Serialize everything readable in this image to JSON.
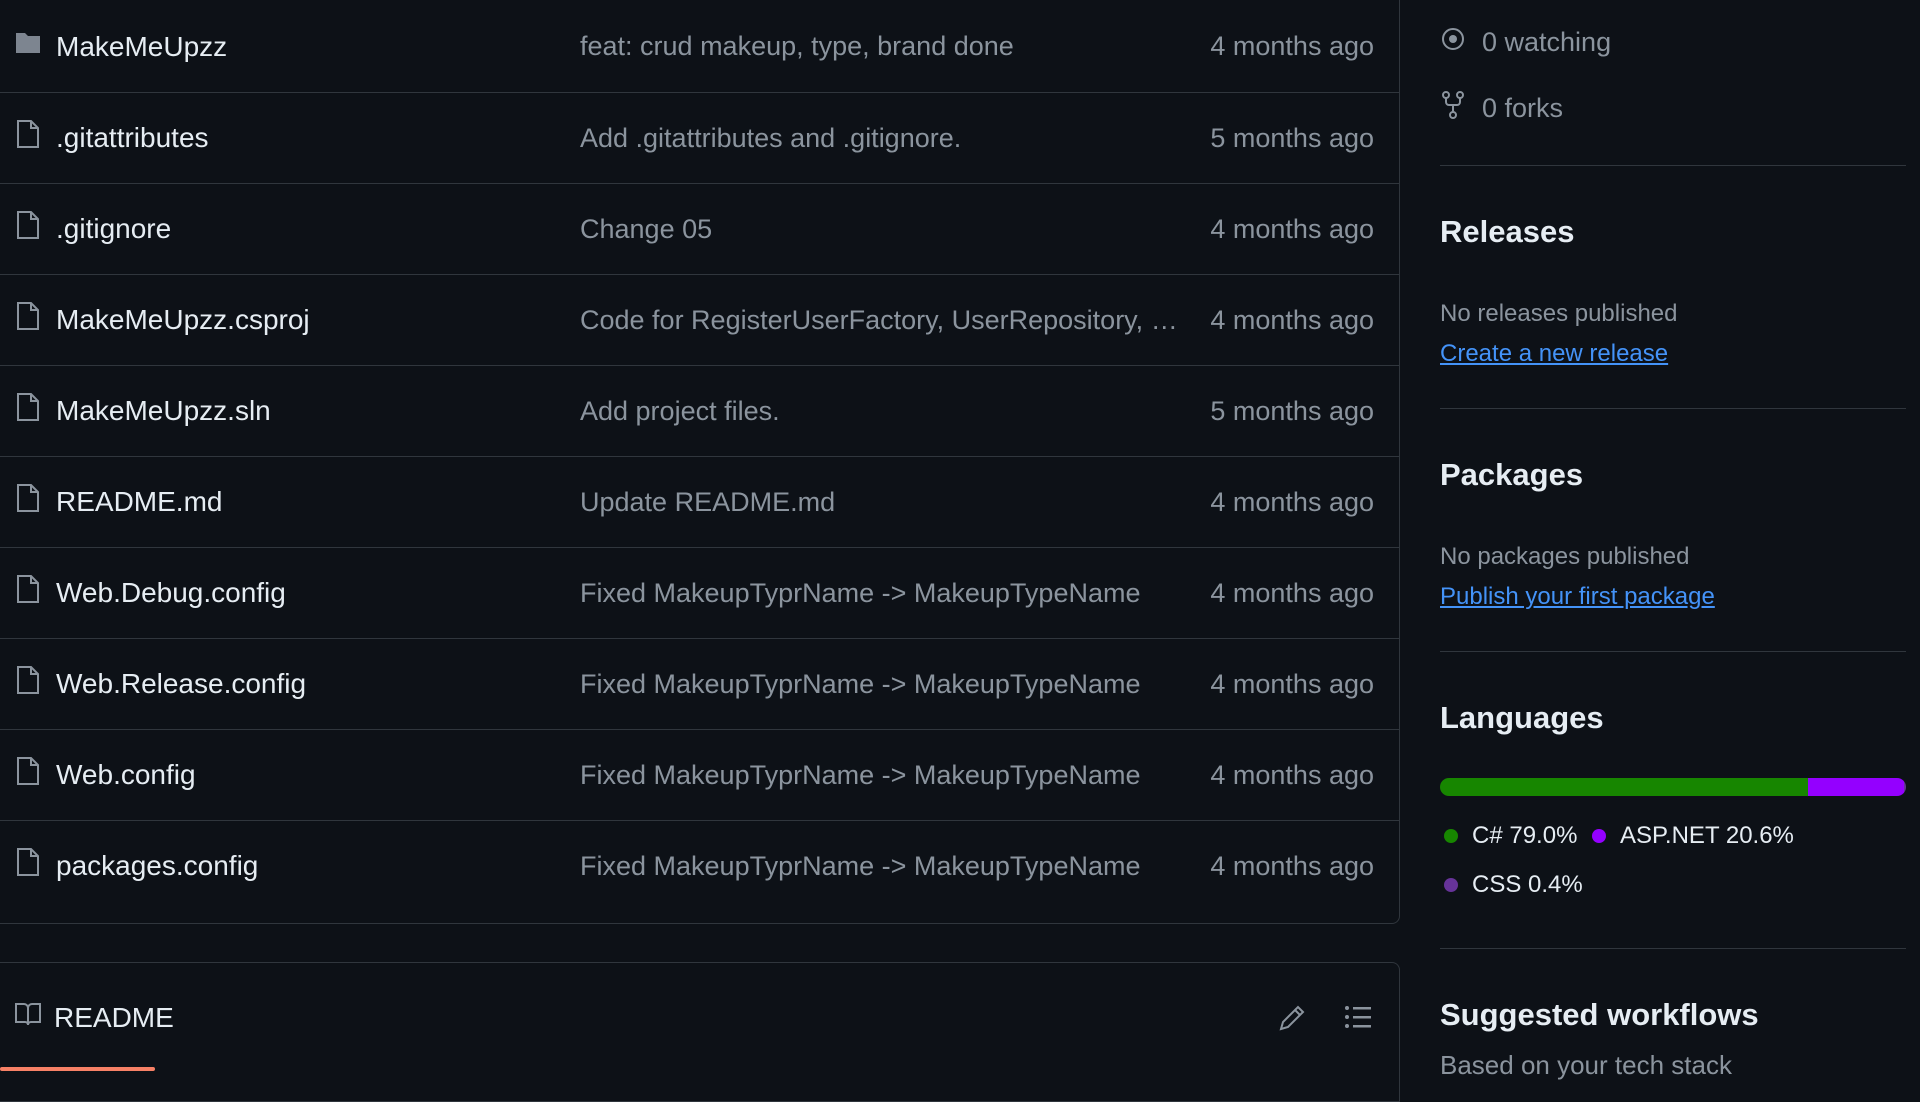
{
  "files": [
    {
      "name": "MakeMeUpzz",
      "type": "folder",
      "message": "feat: crud makeup, type, brand done",
      "date": "4 months ago"
    },
    {
      "name": ".gitattributes",
      "type": "file",
      "message": "Add .gitattributes and .gitignore.",
      "date": "5 months ago"
    },
    {
      "name": ".gitignore",
      "type": "file",
      "message": "Change 05",
      "date": "4 months ago"
    },
    {
      "name": "MakeMeUpzz.csproj",
      "type": "file",
      "message": "Code for RegisterUserFactory, UserRepository, Finished Regis...",
      "date": "4 months ago"
    },
    {
      "name": "MakeMeUpzz.sln",
      "type": "file",
      "message": "Add project files.",
      "date": "5 months ago"
    },
    {
      "name": "README.md",
      "type": "file",
      "message": "Update README.md",
      "date": "4 months ago"
    },
    {
      "name": "Web.Debug.config",
      "type": "file",
      "message": "Fixed MakeupTyprName -> MakeupTypeName",
      "date": "4 months ago"
    },
    {
      "name": "Web.Release.config",
      "type": "file",
      "message": "Fixed MakeupTyprName -> MakeupTypeName",
      "date": "4 months ago"
    },
    {
      "name": "Web.config",
      "type": "file",
      "message": "Fixed MakeupTyprName -> MakeupTypeName",
      "date": "4 months ago"
    },
    {
      "name": "packages.config",
      "type": "file",
      "message": "Fixed MakeupTyprName -> MakeupTypeName",
      "date": "4 months ago"
    }
  ],
  "readme": {
    "tab_label": "README",
    "icons": {
      "tab": "book-icon",
      "edit": "pencil-icon",
      "outline": "list-icon"
    }
  },
  "sidebar": {
    "watching": "0 watching",
    "forks": "0 forks",
    "icons": {
      "watching": "eye-icon",
      "forks": "fork-icon"
    },
    "releases": {
      "heading": "Releases",
      "empty_text": "No releases published",
      "link": "Create a new release"
    },
    "packages": {
      "heading": "Packages",
      "empty_text": "No packages published",
      "link": "Publish your first package"
    },
    "languages": {
      "heading": "Languages",
      "items": [
        {
          "label": "C#",
          "percent": "79.0%",
          "share": 79.0,
          "color": "#178600"
        },
        {
          "label": "ASP.NET",
          "percent": "20.6%",
          "share": 20.6,
          "color": "#9400ff"
        },
        {
          "label": "CSS",
          "percent": "0.4%",
          "share": 0.4,
          "color": "#663399"
        }
      ]
    },
    "workflows": {
      "heading": "Suggested workflows",
      "subtitle": "Based on your tech stack"
    }
  },
  "colors": {
    "background": "#0d1117",
    "border": "#30363d",
    "muted_text": "#8b949e",
    "link": "#4493f8",
    "tab_underline": "#f78166"
  }
}
